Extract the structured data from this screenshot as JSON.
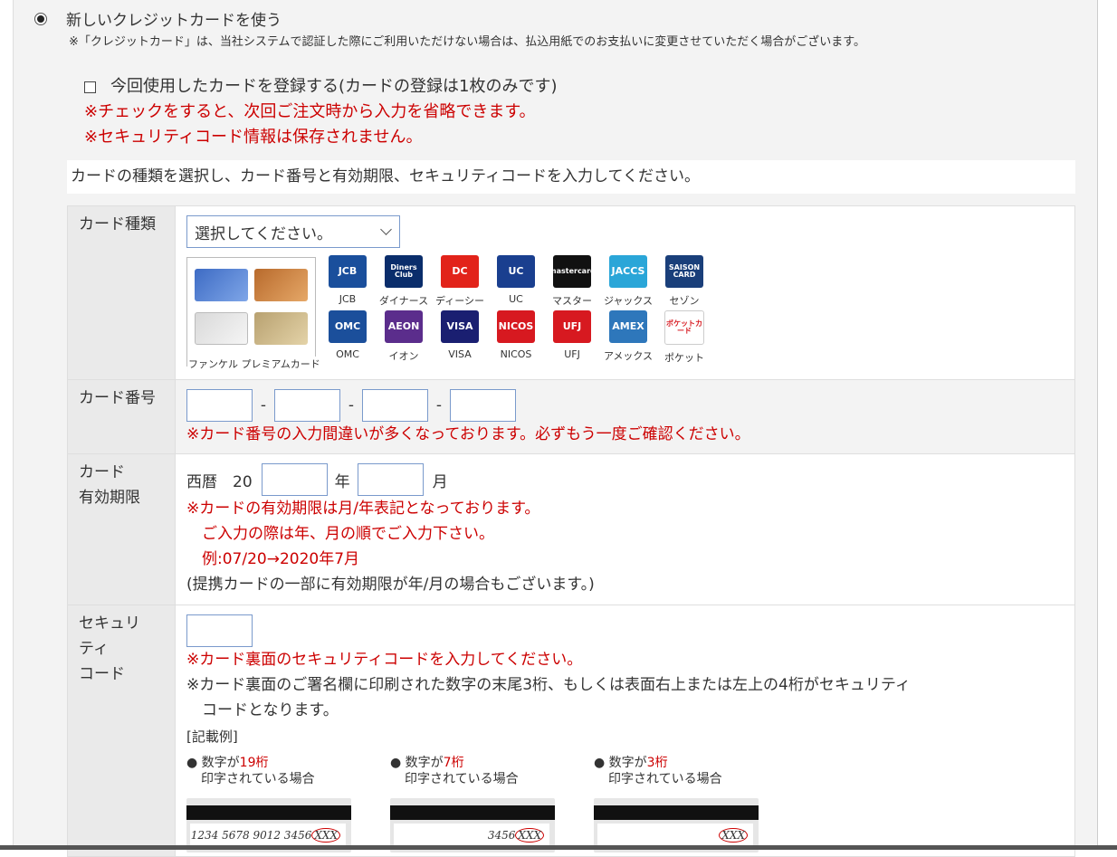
{
  "payment_option": {
    "label": "新しいクレジットカードを使う",
    "notice": "※「クレジットカード」は、当社システムで認証した際にご利用いただけない場合は、払込用紙でのお支払いに変更させていただく場合がございます。"
  },
  "register": {
    "label": "今回使用したカードを登録する(カードの登録は1枚のみです)",
    "note1": "※チェックをすると、次回ご注文時から入力を省略できます。",
    "note2": "※セキュリティコード情報は保存されません。"
  },
  "instruction": "カードの種類を選択し、カード番号と有効期限、セキュリティコードを入力してください。",
  "card_type": {
    "label": "カード種類",
    "select_value": "選択してください。",
    "premium_caption": "ファンケル プレミアムカード",
    "brands": [
      {
        "name": "JCB",
        "logo": "JCB",
        "color": "#1a4f9c"
      },
      {
        "name": "ダイナース",
        "logo": "Diners Club",
        "color": "#0a2d6b"
      },
      {
        "name": "ディーシー",
        "logo": "DC",
        "color": "#e2231a"
      },
      {
        "name": "UC",
        "logo": "UC",
        "color": "#1a3f8f"
      },
      {
        "name": "マスター",
        "logo": "mastercard",
        "color": "#111111"
      },
      {
        "name": "ジャックス",
        "logo": "JACCS",
        "color": "#2aa6d8"
      },
      {
        "name": "セゾン",
        "logo": "SAISON CARD",
        "color": "#1a3f7a"
      },
      {
        "name": "OMC",
        "logo": "OMC",
        "color": "#1b4f9b"
      },
      {
        "name": "イオン",
        "logo": "AEON",
        "color": "#5b2d8c"
      },
      {
        "name": "VISA",
        "logo": "VISA",
        "color": "#1a1f71"
      },
      {
        "name": "NICOS",
        "logo": "NICOS",
        "color": "#d71920"
      },
      {
        "name": "UFJ",
        "logo": "UFJ",
        "color": "#d71920"
      },
      {
        "name": "アメックス",
        "logo": "AMEX",
        "color": "#2e77bb"
      },
      {
        "name": "ポケット",
        "logo": "ポケットカード",
        "color": "#ffffff"
      }
    ]
  },
  "card_number": {
    "label": "カード番号",
    "dash": "-",
    "warning": "※カード番号の入力間違いが多くなっております。必ずもう一度ご確認ください。"
  },
  "expiry": {
    "label_line1": "カード",
    "label_line2": "有効期限",
    "era": "西暦　20",
    "year_unit": "年",
    "month_unit": "月",
    "note1": "※カードの有効期限は月/年表記となっております。",
    "note2": "　ご入力の際は年、月の順でご入力下さい。",
    "note3": "　例:07/20→2020年7月",
    "note4": "(提携カードの一部に有効期限が年/月の場合もございます。)"
  },
  "security": {
    "label_line1": "セキュリ",
    "label_line2": "ティ",
    "label_line3": "コード",
    "note1": "※カード裏面のセキュリティコードを入力してください。",
    "note2": "※カード裏面のご署名欄に印刷された数字の末尾3桁、もしくは表面右上または左上の4桁がセキュリティ",
    "note3": "　コードとなります。",
    "example_title": "[記載例]",
    "examples": [
      {
        "prefix": "● 数字が",
        "digits": "19桁",
        "line2": "印字されている場合",
        "numbers": "1234 5678 9012 3456",
        "cvv": "XXX"
      },
      {
        "prefix": "● 数字が",
        "digits": "7桁",
        "line2": "印字されている場合",
        "numbers": "3456",
        "cvv": "XXX"
      },
      {
        "prefix": "● 数字が",
        "digits": "3桁",
        "line2": "印字されている場合",
        "numbers": "",
        "cvv": "XXX"
      }
    ]
  }
}
